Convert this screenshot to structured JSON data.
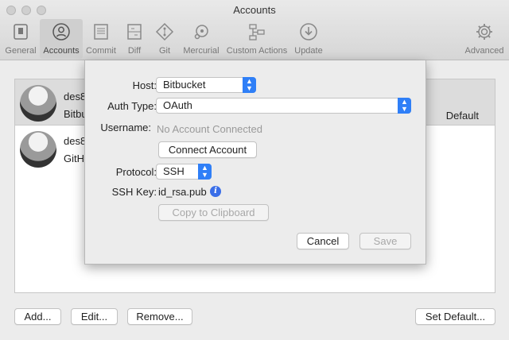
{
  "window": {
    "title": "Accounts"
  },
  "toolbar": {
    "items": [
      {
        "label": "General",
        "icon": "switch-icon"
      },
      {
        "label": "Accounts",
        "icon": "person-icon"
      },
      {
        "label": "Commit",
        "icon": "document-icon"
      },
      {
        "label": "Diff",
        "icon": "diff-icon"
      },
      {
        "label": "Git",
        "icon": "git-diamond-icon"
      },
      {
        "label": "Mercurial",
        "icon": "mercurial-icon"
      },
      {
        "label": "Custom Actions",
        "icon": "flow-icon"
      },
      {
        "label": "Update",
        "icon": "download-icon"
      },
      {
        "label": "Advanced",
        "icon": "gear-icon"
      }
    ],
    "active": "Accounts"
  },
  "accounts": [
    {
      "name": "des8",
      "service": "Bitbu",
      "default_label": "Default"
    },
    {
      "name": "des8",
      "service": "GitH"
    }
  ],
  "buttons": {
    "add": "Add...",
    "edit": "Edit...",
    "remove": "Remove...",
    "set_default": "Set Default..."
  },
  "sheet": {
    "host_label": "Host:",
    "host_value": "Bitbucket",
    "auth_label": "Auth Type:",
    "auth_value": "OAuth",
    "username_label": "Username:",
    "username_placeholder": "No Account Connected",
    "connect_button": "Connect Account",
    "protocol_label": "Protocol:",
    "protocol_value": "SSH",
    "ssh_key_label": "SSH Key:",
    "ssh_key_value": "id_rsa.pub",
    "copy_button": "Copy to Clipboard",
    "cancel_button": "Cancel",
    "save_button": "Save"
  },
  "colors": {
    "accent": "#2f7ff7",
    "info": "#3a6ee8"
  }
}
